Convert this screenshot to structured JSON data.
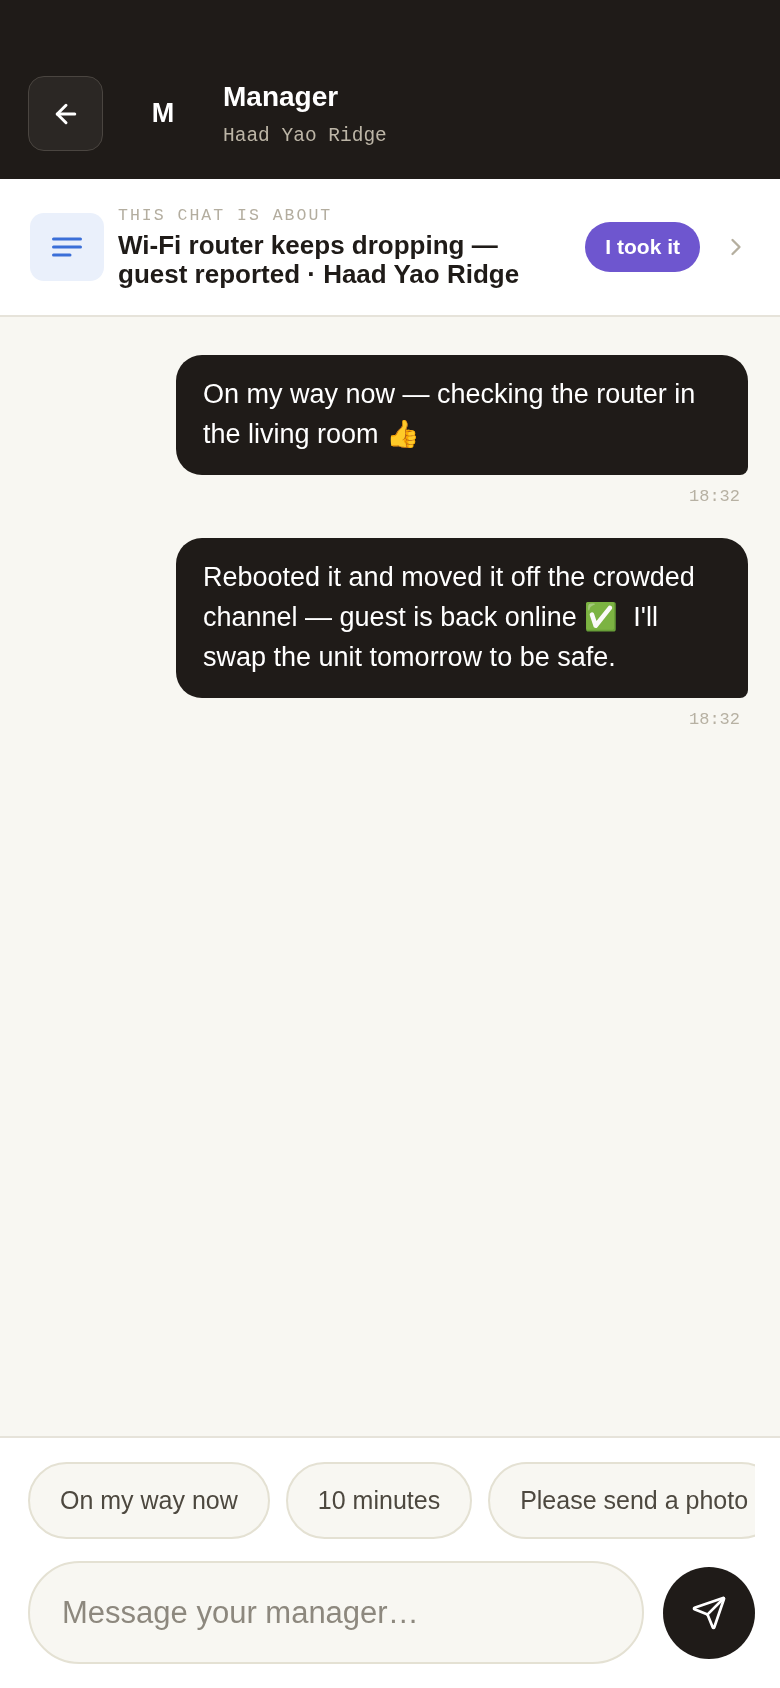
{
  "header": {
    "avatar_initial": "M",
    "name": "Manager",
    "subtitle": "Haad Yao Ridge"
  },
  "topic": {
    "label": "THIS CHAT IS ABOUT",
    "title": "Wi-Fi router keeps dropping — guest reported · Haad Yao Ridge",
    "action": "I took it"
  },
  "messages": [
    {
      "outgoing": true,
      "text": "On my way now — checking the router in the living room 👍",
      "time": "18:32"
    },
    {
      "outgoing": true,
      "text": "Rebooted it and moved it off the crowded channel — guest is back online ✅  I'll swap the unit tomorrow to be safe.",
      "time": "18:32"
    }
  ],
  "quick_replies": [
    {
      "label": "On my way now"
    },
    {
      "label": "10 minutes"
    },
    {
      "label": "Please send a photo"
    }
  ],
  "composer": {
    "placeholder": "Message your manager…"
  }
}
